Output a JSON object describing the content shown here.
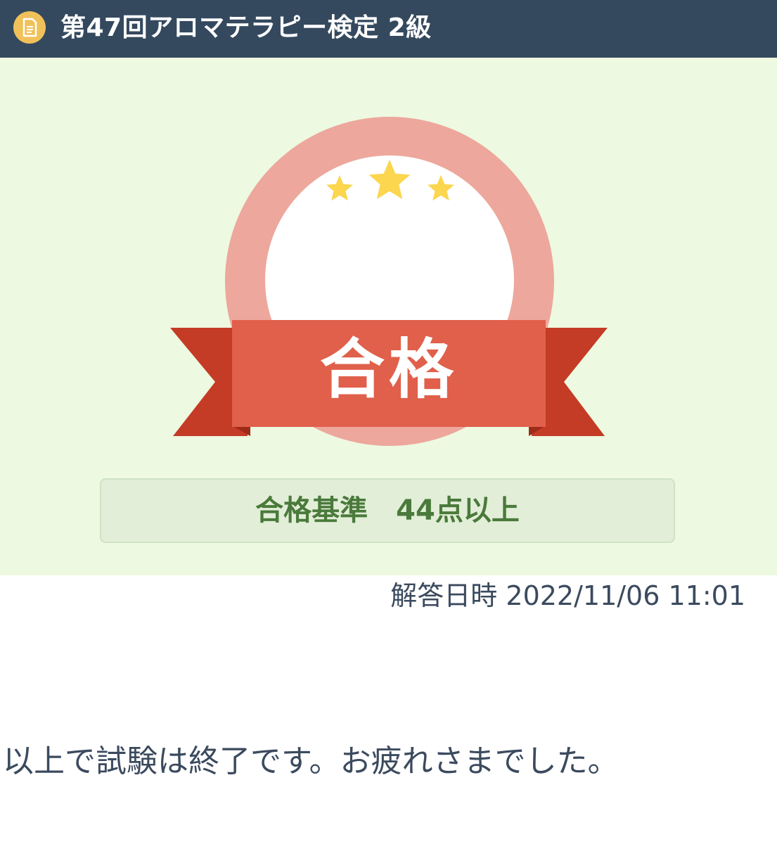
{
  "header": {
    "icon": "document-icon",
    "title": "第47回アロマテラピー検定 2級"
  },
  "result": {
    "label": "合格",
    "stars": 3,
    "criteria": "合格基準　44点以上",
    "answer_date_label": "解答日時",
    "answer_date": "2022/11/06 11:01"
  },
  "message": "以上で試験は終了です。お疲れさまでした。",
  "colors": {
    "header_bg": "#34495e",
    "panel_bg": "#edf9e0",
    "ring": "#eda79c",
    "ribbon": "#e0604b",
    "ribbon_tail": "#c43b26",
    "star": "#fbd64e",
    "criteria_text": "#4a7a3b"
  }
}
